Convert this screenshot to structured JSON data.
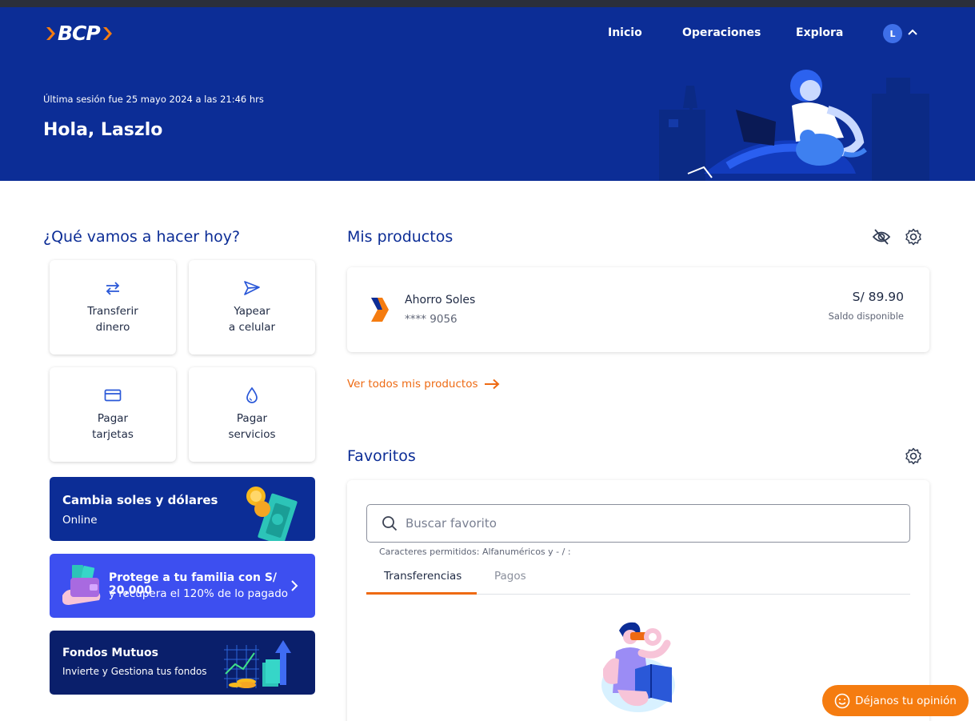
{
  "header": {
    "logo_text": "BCP",
    "nav": {
      "inicio": "Inicio",
      "operaciones": "Operaciones",
      "explora": "Explora"
    },
    "avatar_initial": "L",
    "last_session": "Última sesión fue 25 mayo 2024 a las 21:46 hrs",
    "greeting": "Hola, Laszlo"
  },
  "quick_actions": {
    "title": "¿Qué vamos a hacer hoy?",
    "tiles": [
      {
        "line1": "Transferir",
        "line2": "dinero",
        "icon": "transfer-arrows-icon"
      },
      {
        "line1": "Yapear",
        "line2": "a celular",
        "icon": "send-paper-plane-icon"
      },
      {
        "line1": "Pagar",
        "line2": "tarjetas",
        "icon": "credit-card-icon"
      },
      {
        "line1": "Pagar",
        "line2": "servicios",
        "icon": "water-drop-icon"
      }
    ]
  },
  "banners": {
    "exchange": {
      "title": "Cambia soles y dólares",
      "subtitle": "Online"
    },
    "insurance": {
      "title": "Protege a tu familia con S/ 20,000",
      "subtitle": "y recupera el 120% de lo pagado"
    },
    "funds": {
      "title": "Fondos Mutuos",
      "subtitle": "Invierte y Gestiona tus fondos"
    }
  },
  "products": {
    "title": "Mis productos",
    "account_name": "Ahorro Soles",
    "account_number": "**** 9056",
    "balance": "S/ 89.90",
    "balance_label": "Saldo disponible",
    "see_all": "Ver todos mis productos"
  },
  "favorites": {
    "title": "Favoritos",
    "search_placeholder": "Buscar favorito",
    "hint": "Caracteres permitidos: Alfanuméricos y - / :",
    "tabs": [
      "Transferencias",
      "Pagos"
    ],
    "active_tab": "Transferencias"
  },
  "feedback_button": "Déjanos tu opinión",
  "colors": {
    "brand_blue": "#0c2d96",
    "brand_orange": "#ee6a13",
    "insurance_purple": "#3d4ff0",
    "funds_navy": "#0a1f6b"
  }
}
